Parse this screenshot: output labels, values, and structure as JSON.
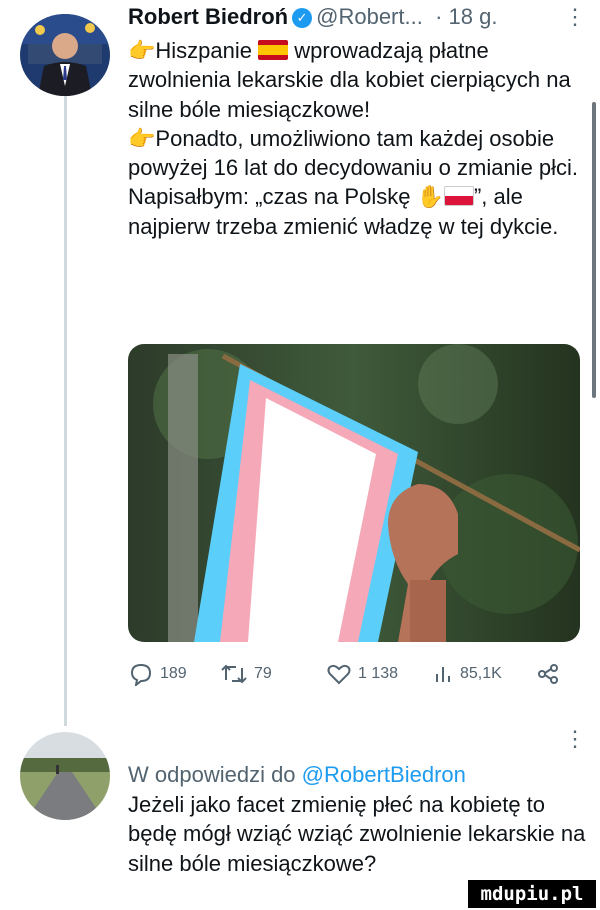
{
  "tweet": {
    "author": "Robert Biedroń",
    "handle": "@Robert...",
    "time": "· 18 g.",
    "paragraphs": {
      "p1": "Hiszpanie",
      "p1b": "wprowadzają płatne zwolnienia lekarskie dla kobiet cierpiących na silne bóle miesiączkowe!",
      "p2": "Ponadto, umożliwiono tam każdej osobie powyżej 16 lat do decydowaniu o zmianie płci.",
      "p3a": "Napisałbym: „czas na Polskę",
      "p3b": "”, ale najpierw trzeba zmienić władzę w tej dykcie."
    },
    "stats": {
      "replies": "189",
      "retweets": "79",
      "likes": "1 138",
      "views": "85,1K"
    }
  },
  "reply": {
    "prefix": "W odpowiedzi do",
    "mention": "@RobertBiedron",
    "text": "Jeżeli jako facet zmienię płeć na kobietę to będę mógł wziąć wziąć zwolnienie lekarskie na silne bóle miesiączkowe?"
  },
  "watermark": "mdupiu.pl",
  "colors": {
    "accent": "#1d9bf0",
    "muted": "#536471",
    "text": "#0f1419"
  }
}
